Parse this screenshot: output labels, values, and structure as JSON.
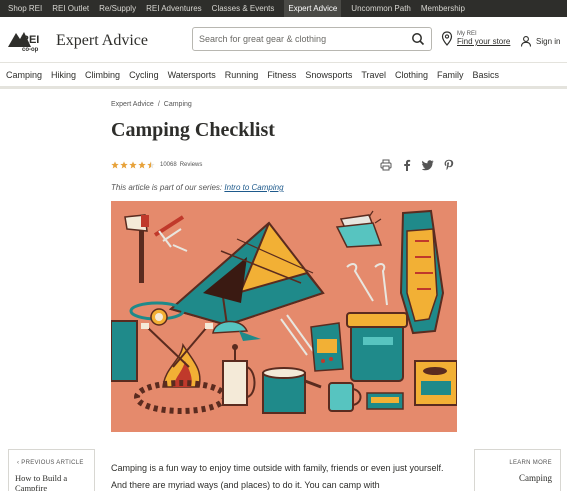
{
  "topbar": {
    "links": [
      "Shop REI",
      "REI Outlet",
      "Re/Supply",
      "REI Adventures",
      "Classes & Events",
      "Expert Advice",
      "Uncommon Path",
      "Membership"
    ],
    "active": "Expert Advice"
  },
  "header": {
    "brand": "Expert Advice",
    "search_placeholder": "Search for great gear & clothing",
    "store_small": "My REI",
    "store_link": "Find your store",
    "signin": "Sign in"
  },
  "catnav": [
    "Camping",
    "Hiking",
    "Climbing",
    "Cycling",
    "Watersports",
    "Running",
    "Fitness",
    "Snowsports",
    "Travel",
    "Clothing",
    "Family",
    "Basics"
  ],
  "article": {
    "breadcrumb": [
      "Expert Advice",
      "Camping"
    ],
    "title": "Camping Checklist",
    "rating": {
      "stars": 4.5,
      "count": "10068",
      "label": "Reviews"
    },
    "series_prefix": "This article is part of our series:",
    "series_link": "Intro to Camping",
    "intro": "Camping is a fun way to enjoy time outside with family, friends or even just yourself. And there are myriad ways (and places) to do it. You can camp with"
  },
  "prev_card": {
    "label": "PREVIOUS ARTICLE",
    "title": "How to Build a Campfire"
  },
  "next_card": {
    "label": "LEARN MORE",
    "title": "Camping"
  },
  "colors": {
    "topbar_bg": "#2e2e2b",
    "hero_bg": "#e58a6c",
    "teal": "#1f8a8a",
    "mustard": "#f2b035",
    "dark_brown": "#5a2b1f",
    "star": "#e7a23a",
    "link": "#1e5a8c"
  },
  "icons": [
    "rei-logo-icon",
    "search-icon",
    "location-pin-icon",
    "user-icon",
    "print-icon",
    "facebook-icon",
    "twitter-icon",
    "pinterest-icon",
    "chevron-left-icon",
    "star-icon"
  ]
}
